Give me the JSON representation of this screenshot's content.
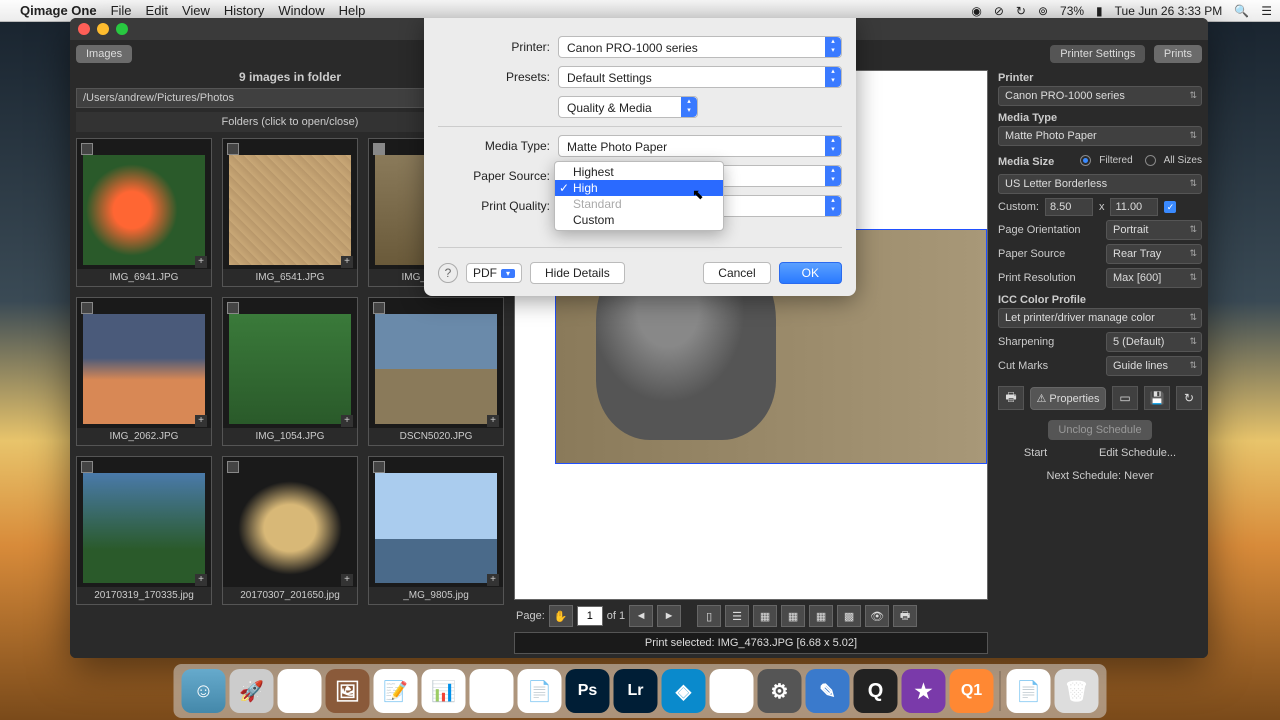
{
  "menubar": {
    "app": "Qimage One",
    "items": [
      "File",
      "Edit",
      "View",
      "History",
      "Window",
      "Help"
    ],
    "battery": "73%",
    "clock": "Tue Jun 26  3:33 PM"
  },
  "window": {
    "title": "Qimage One",
    "left_tab": "Images",
    "right_tabs": {
      "a": "Printer Settings",
      "b": "Prints"
    }
  },
  "left": {
    "count": "9 images in folder",
    "path": "/Users/andrew/Pictures/Photos",
    "folders_hdr": "Folders (click to open/close)",
    "thumbs": [
      "IMG_6941.JPG",
      "IMG_6541.JPG",
      "IMG_4763.JPG",
      "IMG_2062.JPG",
      "IMG_1054.JPG",
      "DSCN5020.JPG",
      "20170319_170335.jpg",
      "20170307_201650.jpg",
      "_MG_9805.jpg"
    ]
  },
  "preview": {
    "page_label": "Page:",
    "page_value": "1",
    "page_of": "of 1",
    "status": "Print selected: IMG_4763.JPG [6.68 x 5.02]"
  },
  "rpanel": {
    "printer_lbl": "Printer",
    "printer_val": "Canon PRO-1000 series",
    "media_type_lbl": "Media Type",
    "media_type_val": "Matte Photo Paper",
    "media_size_lbl": "Media Size",
    "filtered": "Filtered",
    "all_sizes": "All Sizes",
    "media_size_val": "US Letter Borderless",
    "custom_lbl": "Custom:",
    "custom_w": "8.50",
    "custom_x": "x",
    "custom_h": "11.00",
    "orient_lbl": "Page Orientation",
    "orient_val": "Portrait",
    "source_lbl": "Paper Source",
    "source_val": "Rear Tray",
    "res_lbl": "Print Resolution",
    "res_val": "Max [600]",
    "icc_lbl": "ICC Color Profile",
    "icc_val": "Let printer/driver manage color",
    "sharp_lbl": "Sharpening",
    "sharp_val": "5 (Default)",
    "cut_lbl": "Cut Marks",
    "cut_val": "Guide lines",
    "props": "Properties",
    "unclog": "Unclog Schedule",
    "start": "Start",
    "edit_sched": "Edit Schedule...",
    "next_sched": "Next Schedule: Never"
  },
  "sheet": {
    "printer_lbl": "Printer:",
    "printer_val": "Canon PRO-1000 series",
    "presets_lbl": "Presets:",
    "presets_val": "Default Settings",
    "section_val": "Quality & Media",
    "mediatype_lbl": "Media Type:",
    "mediatype_val": "Matte Photo Paper",
    "papersource_lbl": "Paper Source:",
    "papersource_val": "Rear Tray",
    "printquality_lbl": "Print Quality:",
    "pdf": "PDF",
    "hide": "Hide Details",
    "cancel": "Cancel",
    "ok": "OK",
    "quality_opts": {
      "o1": "Highest",
      "o2": "High",
      "o3": "Standard",
      "o4": "Custom"
    }
  }
}
